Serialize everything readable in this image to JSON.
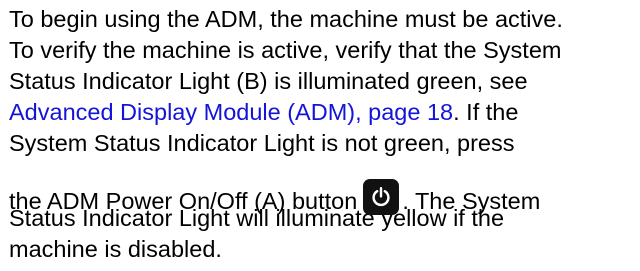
{
  "paragraph": {
    "line1": "To begin using the ADM, the machine must be active.",
    "line2": "To verify the machine is active, verify that the System",
    "line3": "Status Indicator Light (B) is illuminated green, see",
    "line4_link": "Advanced Display Module (ADM), page 18",
    "line4_after": ".  If the",
    "line5": "System Status Indicator Light is not green, press",
    "line6_before": "the ADM Power On/Off (A) button",
    "line6_after": ".  The System",
    "line7": "Status Indicator Light will illuminate yellow if the",
    "line8": "machine is disabled."
  },
  "icons": {
    "power_button": "power-icon"
  },
  "colors": {
    "link": "#1414d8",
    "text": "#000000",
    "button": "#111111"
  }
}
